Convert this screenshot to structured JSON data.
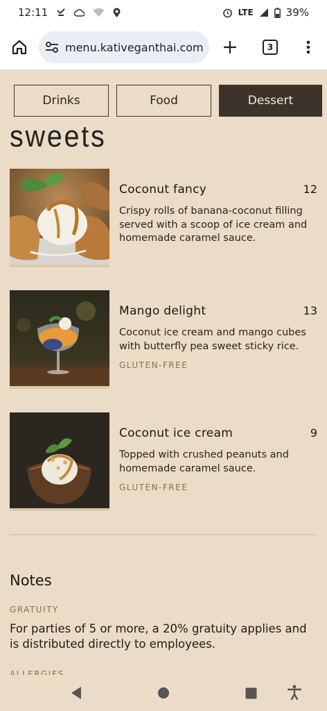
{
  "status_bar": {
    "time": "12:11",
    "network": "LTE",
    "battery": "39%"
  },
  "browser": {
    "url": "menu.kativeganthai.com",
    "tab_count": "3"
  },
  "categories": [
    {
      "label": "Drinks",
      "active": false
    },
    {
      "label": "Food",
      "active": false
    },
    {
      "label": "Dessert",
      "active": true
    }
  ],
  "section": {
    "title": "sweets"
  },
  "items": [
    {
      "name": "Coconut fancy",
      "price": "12",
      "description": "Crispy rolls of banana-coconut filling served with a scoop of ice cream and homemade caramel sauce.",
      "tag": ""
    },
    {
      "name": "Mango delight",
      "price": "13",
      "description": "Coconut ice cream and mango cubes with butterfly pea sweet sticky rice.",
      "tag": "GLUTEN-FREE"
    },
    {
      "name": "Coconut ice cream",
      "price": "9",
      "description": "Topped with crushed peanuts and homemade caramel sauce.",
      "tag": "GLUTEN-FREE"
    }
  ],
  "notes": {
    "title": "Notes",
    "gratuity_label": "GRATUITY",
    "gratuity_text": "For parties of 5 or more, a 20% gratuity applies and is distributed directly to employees.",
    "allergies_label": "ALLERGIES"
  },
  "icons": {
    "home": "home-icon",
    "site_settings": "tune-icon",
    "new_tab": "plus-icon",
    "more": "more-vert-icon",
    "back": "back-triangle-icon",
    "home_nav": "home-circle-icon",
    "recents": "recents-square-icon",
    "accessibility": "accessibility-icon"
  },
  "colors": {
    "page_bg": "#ebdcc7",
    "active_tab_bg": "#3b332a",
    "tag_color": "#8b6f4a"
  }
}
